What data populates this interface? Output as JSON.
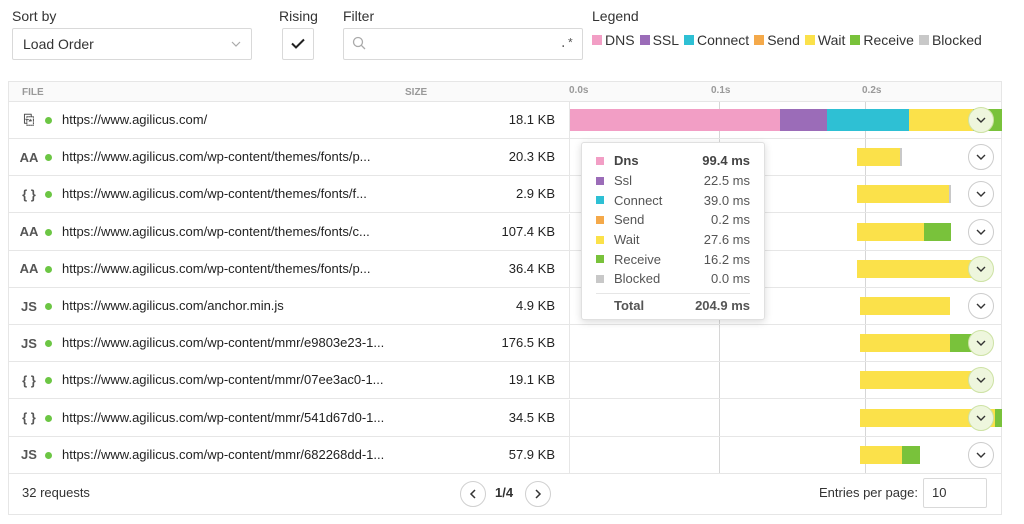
{
  "controls": {
    "sort_label": "Sort by",
    "sort_value": "Load Order",
    "rising_label": "Rising",
    "rising_checked": true,
    "filter_label": "Filter",
    "filter_value": "",
    "filter_regex": ".*",
    "legend_label": "Legend"
  },
  "legend": [
    {
      "label": "DNS",
      "color": "#f29ec5"
    },
    {
      "label": "SSL",
      "color": "#9b6cb8"
    },
    {
      "label": "Connect",
      "color": "#2ec0d4"
    },
    {
      "label": "Send",
      "color": "#f4a94a"
    },
    {
      "label": "Wait",
      "color": "#fbe14a"
    },
    {
      "label": "Receive",
      "color": "#79c23b"
    },
    {
      "label": "Blocked",
      "color": "#c8c8c8"
    }
  ],
  "table": {
    "headers": {
      "file": "FILE",
      "size": "SIZE"
    },
    "ticks": [
      "0.0s",
      "0.1s",
      "0.2s"
    ],
    "rows": [
      {
        "icon": "page-icon",
        "glyph": "⎘",
        "url": "https://www.agilicus.com/",
        "size": "18.1 KB"
      },
      {
        "icon": "font-icon",
        "glyph": "AA",
        "url": "https://www.agilicus.com/wp-content/themes/fonts/p...",
        "size": "20.3 KB"
      },
      {
        "icon": "json-icon",
        "glyph": "{ }",
        "url": "https://www.agilicus.com/wp-content/themes/fonts/f...",
        "size": "2.9 KB"
      },
      {
        "icon": "font-icon",
        "glyph": "AA",
        "url": "https://www.agilicus.com/wp-content/themes/fonts/c...",
        "size": "107.4 KB"
      },
      {
        "icon": "font-icon",
        "glyph": "AA",
        "url": "https://www.agilicus.com/wp-content/themes/fonts/p...",
        "size": "36.4 KB"
      },
      {
        "icon": "script-icon",
        "glyph": "JS",
        "url": "https://www.agilicus.com/anchor.min.js",
        "size": "4.9 KB"
      },
      {
        "icon": "script-icon",
        "glyph": "JS",
        "url": "https://www.agilicus.com/wp-content/mmr/e9803e23-1...",
        "size": "176.5 KB"
      },
      {
        "icon": "json-icon",
        "glyph": "{ }",
        "url": "https://www.agilicus.com/wp-content/mmr/07ee3ac0-1...",
        "size": "19.1 KB"
      },
      {
        "icon": "json-icon",
        "glyph": "{ }",
        "url": "https://www.agilicus.com/wp-content/mmr/541d67d0-1...",
        "size": "34.5 KB"
      },
      {
        "icon": "script-icon",
        "glyph": "JS",
        "url": "https://www.agilicus.com/wp-content/mmr/682268dd-1...",
        "size": "57.9 KB"
      }
    ]
  },
  "tooltip": {
    "rows": [
      {
        "name": "Dns",
        "value": "99.4 ms",
        "color": "#f29ec5",
        "bold": true
      },
      {
        "name": "Ssl",
        "value": "22.5 ms",
        "color": "#9b6cb8"
      },
      {
        "name": "Connect",
        "value": "39.0 ms",
        "color": "#2ec0d4"
      },
      {
        "name": "Send",
        "value": "0.2 ms",
        "color": "#f4a94a"
      },
      {
        "name": "Wait",
        "value": "27.6 ms",
        "color": "#fbe14a"
      },
      {
        "name": "Receive",
        "value": "16.2 ms",
        "color": "#79c23b"
      },
      {
        "name": "Blocked",
        "value": "0.0 ms",
        "color": "#c8c8c8"
      }
    ],
    "total_label": "Total",
    "total_value": "204.9 ms"
  },
  "footer": {
    "request_count": "32 requests",
    "page": "1/4",
    "entries_label": "Entries per page:",
    "entries_value": "10"
  }
}
